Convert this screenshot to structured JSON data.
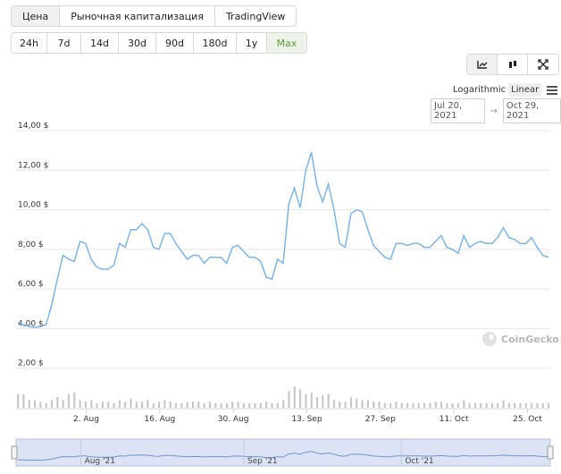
{
  "view_tabs": [
    {
      "label": "Цена",
      "active": true
    },
    {
      "label": "Рыночная капитализация",
      "active": false
    },
    {
      "label": "TradingView",
      "active": false
    }
  ],
  "range_tabs": [
    {
      "label": "24h",
      "w": 40
    },
    {
      "label": "7d",
      "w": 38
    },
    {
      "label": "14d",
      "w": 42
    },
    {
      "label": "30d",
      "w": 42
    },
    {
      "label": "90d",
      "w": 42
    },
    {
      "label": "180d",
      "w": 48
    },
    {
      "label": "1y",
      "w": 34
    },
    {
      "label": "Max",
      "w": 44,
      "active": true
    }
  ],
  "chart_type_icons": [
    "line-chart-icon",
    "candlestick-icon",
    "fullscreen-icon"
  ],
  "scale": {
    "logarithmic": "Logarithmic",
    "linear": "Linear",
    "active": "linear"
  },
  "date_range": {
    "from": "Jul 20, 2021",
    "arrow": "→",
    "to": "Oct 29, 2021"
  },
  "watermark": "CoinGecko",
  "colors": {
    "line": "#7cb5ec",
    "volume": "#c8c8c8",
    "grid": "#e6e6e6",
    "navigator_bg": "#dbe3f5",
    "accent_green": "#5a9b3c"
  },
  "chart_data": {
    "type": "line",
    "y_tick_labels": [
      "14,00 $",
      "12,00 $",
      "10,00 $",
      "8,00 $",
      "6,00 $",
      "4,00 $",
      "2,00 $"
    ],
    "y_ticks": [
      14,
      12,
      10,
      8,
      6,
      4,
      2
    ],
    "ylim": [
      0,
      14
    ],
    "x_tick_labels": [
      "2. Aug",
      "16. Aug",
      "30. Aug",
      "13. Sep",
      "27. Sep",
      "11. Oct",
      "25. Oct"
    ],
    "x_ticks": [
      "2021-08-02",
      "2021-08-16",
      "2021-08-30",
      "2021-09-13",
      "2021-09-27",
      "2021-10-11",
      "2021-10-25"
    ],
    "x_start": "2021-07-20",
    "x_end": "2021-10-29",
    "navigator_labels": [
      "Aug '21",
      "Sep '21",
      "Oct '21"
    ],
    "navigator_ticks": [
      "2021-08-01",
      "2021-09-01",
      "2021-10-01"
    ],
    "price": [
      4.3,
      4.2,
      4.1,
      4.05,
      4.1,
      4.2,
      5.2,
      6.5,
      7.7,
      7.5,
      7.4,
      8.4,
      8.3,
      7.5,
      7.1,
      7.0,
      7.0,
      7.2,
      8.3,
      8.1,
      9.0,
      9.0,
      9.3,
      9.0,
      8.1,
      8.0,
      8.8,
      8.8,
      8.3,
      7.9,
      7.5,
      7.7,
      7.7,
      7.3,
      7.6,
      7.6,
      7.6,
      7.3,
      8.1,
      8.2,
      7.9,
      7.6,
      7.6,
      7.4,
      6.6,
      6.5,
      7.5,
      7.3,
      10.3,
      11.1,
      10.1,
      12.0,
      12.9,
      11.2,
      10.4,
      11.3,
      10.0,
      8.3,
      8.1,
      9.8,
      10.0,
      9.9,
      9.0,
      8.2,
      7.9,
      7.6,
      7.5,
      8.3,
      8.3,
      8.2,
      8.3,
      8.3,
      8.1,
      8.1,
      8.4,
      8.7,
      8.1,
      8.0,
      7.8,
      8.7,
      8.1,
      8.3,
      8.4,
      8.3,
      8.3,
      8.6,
      9.1,
      8.6,
      8.5,
      8.3,
      8.3,
      8.6,
      8.1,
      7.7,
      7.6
    ],
    "volume": [
      0.9,
      0.9,
      0.5,
      0.5,
      0.4,
      0.3,
      0.5,
      0.7,
      0.5,
      0.9,
      1.0,
      0.5,
      0.4,
      0.5,
      0.3,
      0.4,
      0.4,
      0.3,
      0.5,
      0.4,
      0.6,
      0.4,
      0.4,
      0.5,
      0.3,
      0.4,
      0.5,
      0.4,
      0.3,
      0.3,
      0.4,
      0.4,
      0.4,
      0.3,
      0.4,
      0.3,
      0.3,
      0.3,
      0.4,
      0.4,
      0.3,
      0.3,
      0.3,
      0.3,
      0.4,
      0.3,
      0.3,
      0.5,
      1.1,
      1.4,
      1.2,
      0.9,
      1.0,
      0.7,
      0.8,
      0.9,
      0.5,
      0.4,
      0.4,
      0.7,
      0.6,
      0.5,
      0.5,
      0.4,
      0.4,
      0.3,
      0.3,
      0.4,
      0.3,
      0.3,
      0.3,
      0.3,
      0.3,
      0.3,
      0.4,
      0.4,
      0.3,
      0.3,
      0.3,
      0.5,
      0.3,
      0.3,
      0.3,
      0.3,
      0.3,
      0.3,
      0.5,
      0.3,
      0.3,
      0.3,
      0.3,
      0.3,
      0.3,
      0.3,
      0.3
    ]
  }
}
